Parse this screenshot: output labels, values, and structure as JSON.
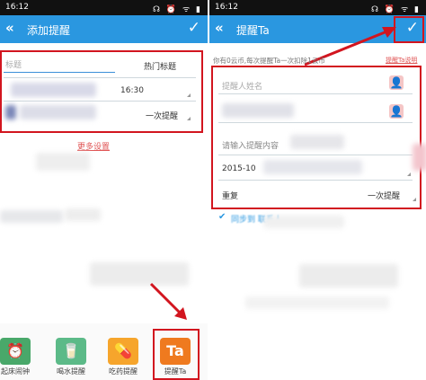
{
  "left": {
    "status_time": "16:12",
    "title": "添加提醒",
    "title_field_placeholder": "标题",
    "hot_titles": "热门标题",
    "time": "16:30",
    "repeat": "一次提醒",
    "more_settings": "更多设置",
    "apps": [
      {
        "label": "起床闹钟",
        "icon": "alarm-clock-icon",
        "color": "#49a86a",
        "glyph": "⏰"
      },
      {
        "label": "喝水提醒",
        "icon": "water-glass-icon",
        "color": "#5cba88",
        "glyph": "🥛"
      },
      {
        "label": "吃药提醒",
        "icon": "pill-icon",
        "color": "#f6a52c",
        "glyph": "💊"
      },
      {
        "label": "提醒Ta",
        "icon": "ta-icon",
        "color": "#ef7a1f",
        "glyph": "Ta"
      }
    ]
  },
  "right": {
    "status_time": "16:12",
    "title": "提醒Ta",
    "info": "你有0云币,每次提醒Ta一次扣除1云币",
    "info_link": "提醒Ta说明",
    "name_placeholder": "提醒人姓名",
    "content_placeholder": "请输入提醒内容",
    "date": "2015-10",
    "repeat_label": "重复",
    "repeat_value": "一次提醒",
    "sync_label": "同步到 联系人"
  },
  "colors": {
    "accent": "#2a97e0",
    "highlight": "#d2151f",
    "link": "#e05555"
  }
}
